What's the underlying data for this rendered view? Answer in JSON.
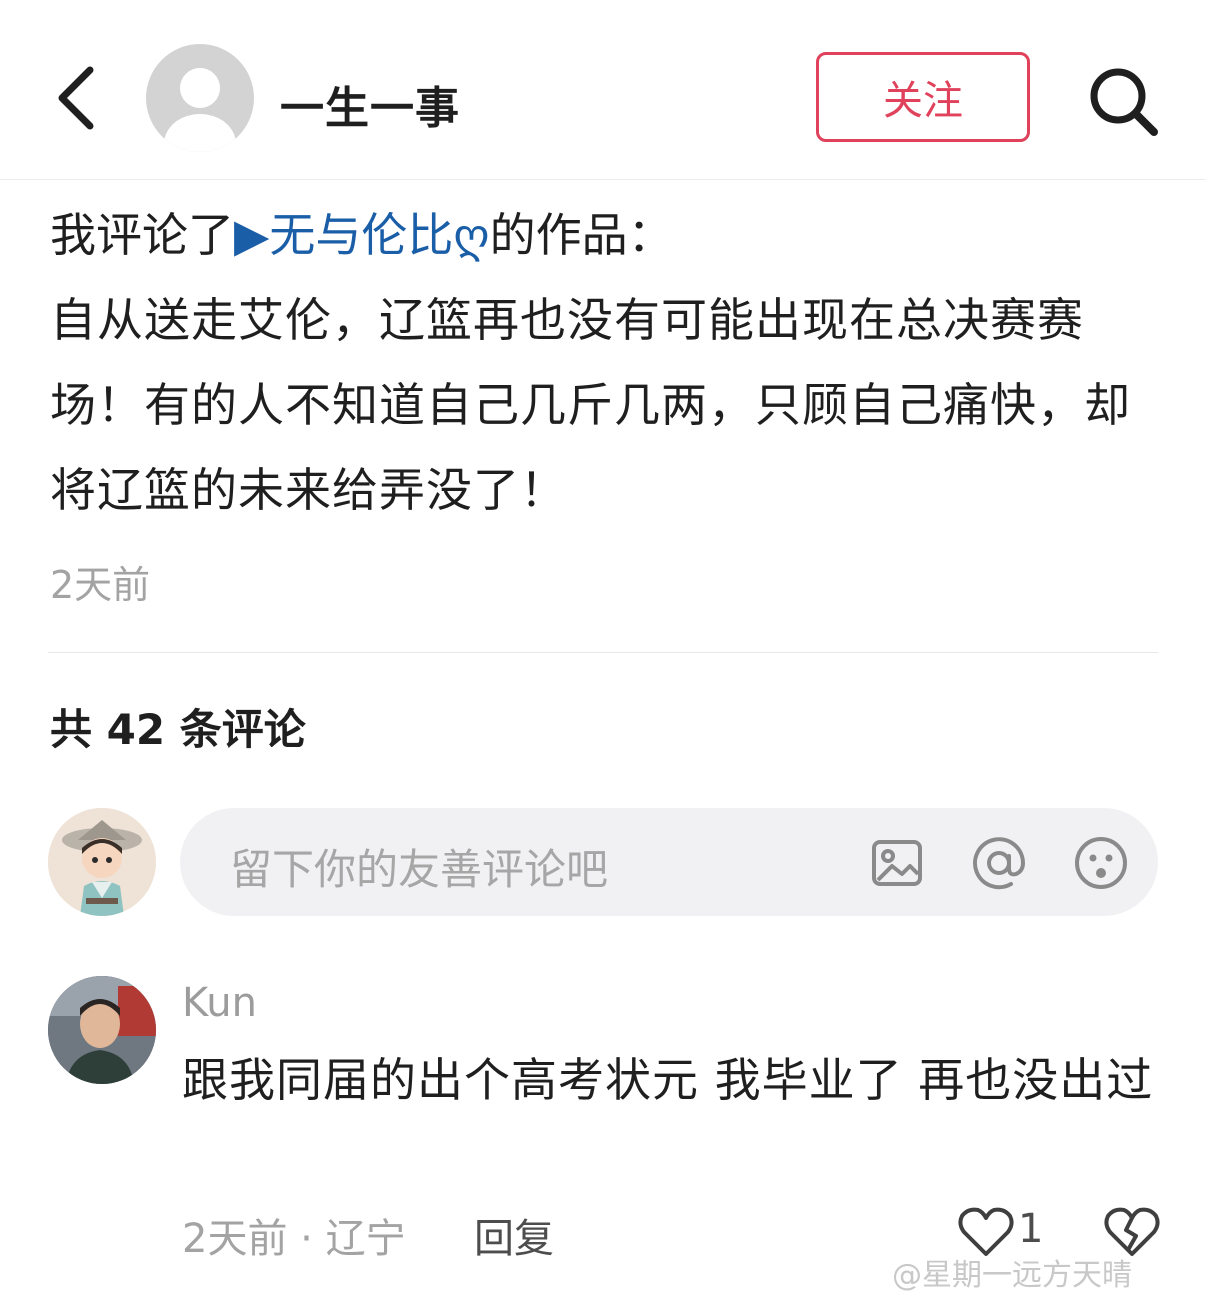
{
  "header": {
    "username": "一生一事",
    "follow_label": "关注",
    "icons": [
      "back-arrow-icon",
      "avatar-placeholder-icon",
      "search-icon"
    ]
  },
  "post": {
    "prefix": "我评论了",
    "link_marker": "▶",
    "link_text": "无与伦比ღ",
    "suffix": "的作品：",
    "body": "自从送走艾伦，辽篮再也没有可能出现在总决赛赛场！有的人不知道自己几斤几两，只顾自己痛快，却将辽篮的未来给弄没了！",
    "time": "2天前"
  },
  "comments_section": {
    "count_label": "共 42 条评论",
    "input_placeholder": "留下你的友善评论吧",
    "input_icons": [
      "image-icon",
      "at-icon",
      "emoji-icon"
    ]
  },
  "comments": [
    {
      "name": "Kun",
      "text": "跟我同届的出个高考状元 我毕业了 再也没出过",
      "meta": "2天前 · 辽宁",
      "reply_label": "回复",
      "likes": "1"
    }
  ],
  "watermark": "@星期一远方天晴",
  "colors": {
    "accent": "#e0415b",
    "link": "#1a5ea8",
    "muted": "#a3a3a3"
  }
}
